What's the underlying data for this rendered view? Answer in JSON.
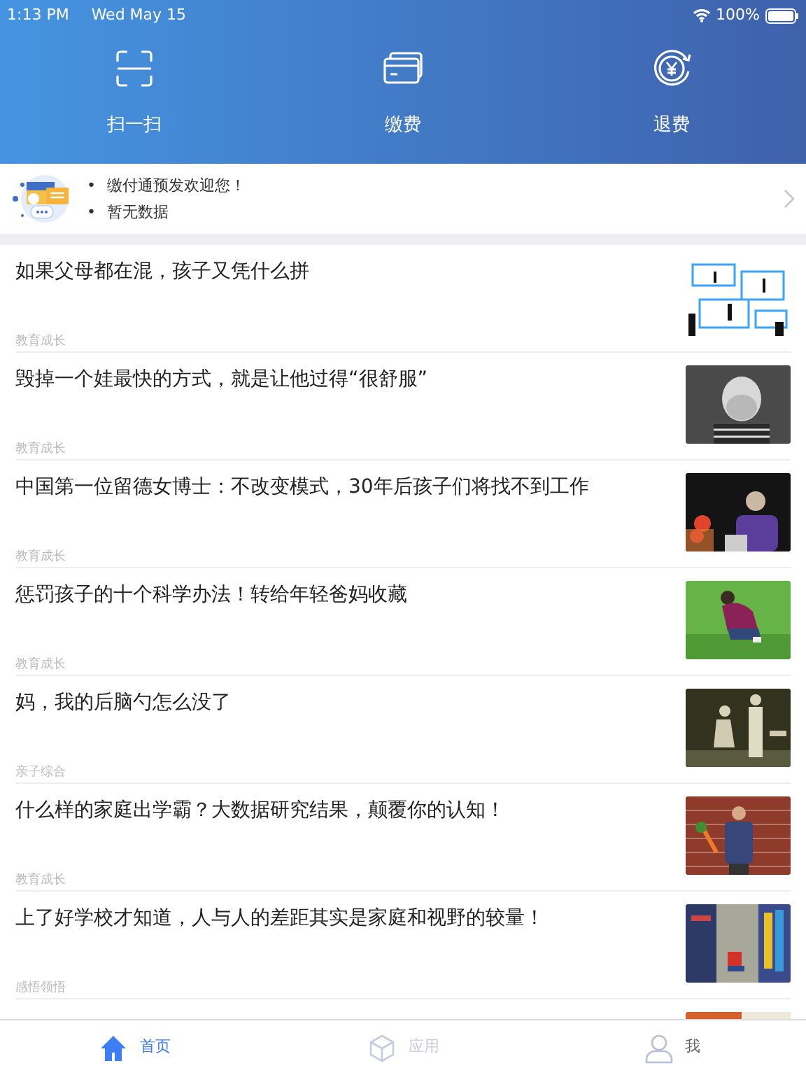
{
  "status_bar": {
    "time": "1:13 PM",
    "date": "Wed May 15",
    "battery": "100%"
  },
  "actions": [
    {
      "kind": "scan",
      "label": "扫一扫"
    },
    {
      "kind": "pay",
      "label": "缴费"
    },
    {
      "kind": "refund",
      "label": "退费"
    }
  ],
  "notice": {
    "items": [
      {
        "bullet": "•",
        "text": "缴付通预发欢迎您！"
      },
      {
        "bullet": "•",
        "text": "暂无数据"
      }
    ]
  },
  "articles": [
    {
      "title": "如果父母都在混，孩子又凭什么拼",
      "category": "教育成长",
      "thumbnail": {
        "kind": "picture"
      }
    },
    {
      "title": "毁掉一个娃最快的方式，就是让他过得“很舒服”",
      "category": "教育成长",
      "thumbnail": {
        "kind": "picture"
      }
    },
    {
      "title": "中国第一位留德女博士：不改变模式，30年后孩子们将找不到工作",
      "category": "教育成长",
      "thumbnail": {
        "kind": "picture"
      }
    },
    {
      "title": "惩罚孩子的十个科学办法！转给年轻爸妈收藏",
      "category": "教育成长",
      "thumbnail": {
        "kind": "picture"
      }
    },
    {
      "title": "妈，我的后脑勺怎么没了",
      "category": "亲子综合",
      "thumbnail": {
        "kind": "picture"
      }
    },
    {
      "title": "什么样的家庭出学霸？大数据研究结果，颠覆你的认知！",
      "category": "教育成长",
      "thumbnail": {
        "kind": "picture"
      }
    },
    {
      "title": "上了好学校才知道，人与人的差距其实是家庭和视野的较量！",
      "category": "感悟领悟",
      "thumbnail": {
        "kind": "picture"
      }
    },
    {
      "thumbnail": {
        "kind": "picture"
      }
    }
  ],
  "tabs": [
    {
      "kind": "home",
      "label": "首页",
      "selected": true,
      "disabled": false
    },
    {
      "kind": "apps",
      "label": "应用",
      "selected": false,
      "disabled": true
    },
    {
      "kind": "me",
      "label": "我",
      "selected": false,
      "disabled": false
    }
  ]
}
